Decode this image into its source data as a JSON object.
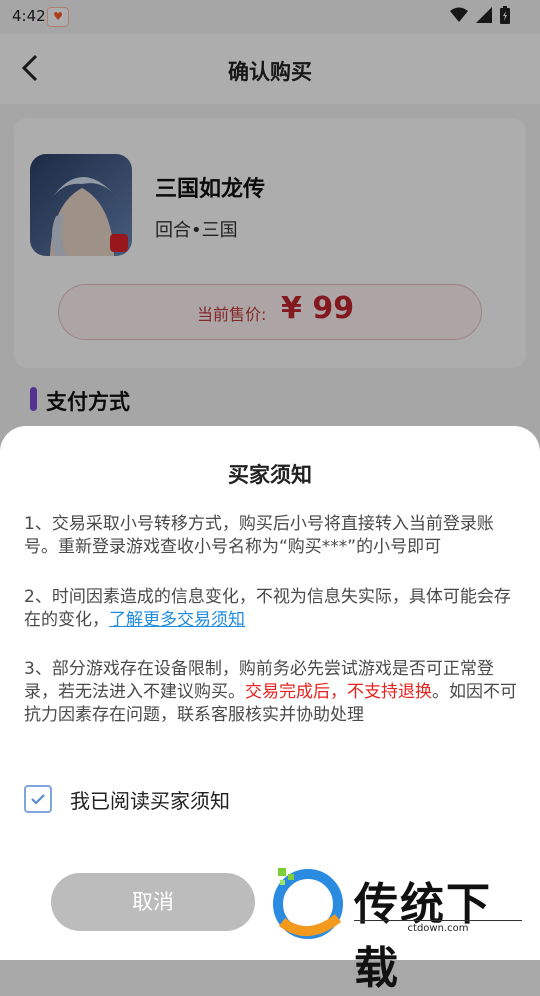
{
  "status_bar": {
    "time": "4:42"
  },
  "nav": {
    "title": "确认购买"
  },
  "game": {
    "name": "三国如龙传",
    "tags": "回合•三国"
  },
  "price": {
    "label": "当前售价:",
    "value": "¥ 99"
  },
  "payment": {
    "section_title": "支付方式"
  },
  "notice": {
    "title": "买家须知",
    "item1": "1、交易采取小号转移方式，购买后小号将直接转入当前登录账号。重新登录游戏查收小号名称为“购买***”的小号即可",
    "item2_text": "2、时间因素造成的信息变化，不视为信息失实际，具体可能会存在的变化，",
    "item2_link": "了解更多交易须知",
    "item3_a": "3、部分游戏存在设备限制，购前务必先尝试游戏是否可正常登录，若无法进入不建议购买。",
    "item3_warn": "交易完成后，不支持退换",
    "item3_b": "。如因不可抗力因素存在问题，联系客服核实并协助处理",
    "agree_label": "我已阅读买家须知",
    "agree_checked": true
  },
  "actions": {
    "cancel_label": "取消"
  },
  "watermark": {
    "text": "传统下载",
    "url": "ctdown.com"
  },
  "colors": {
    "accent": "#1f8ce0",
    "price": "#c2262e",
    "warn": "#e8231f",
    "section_bar": "#7b4bd8"
  }
}
